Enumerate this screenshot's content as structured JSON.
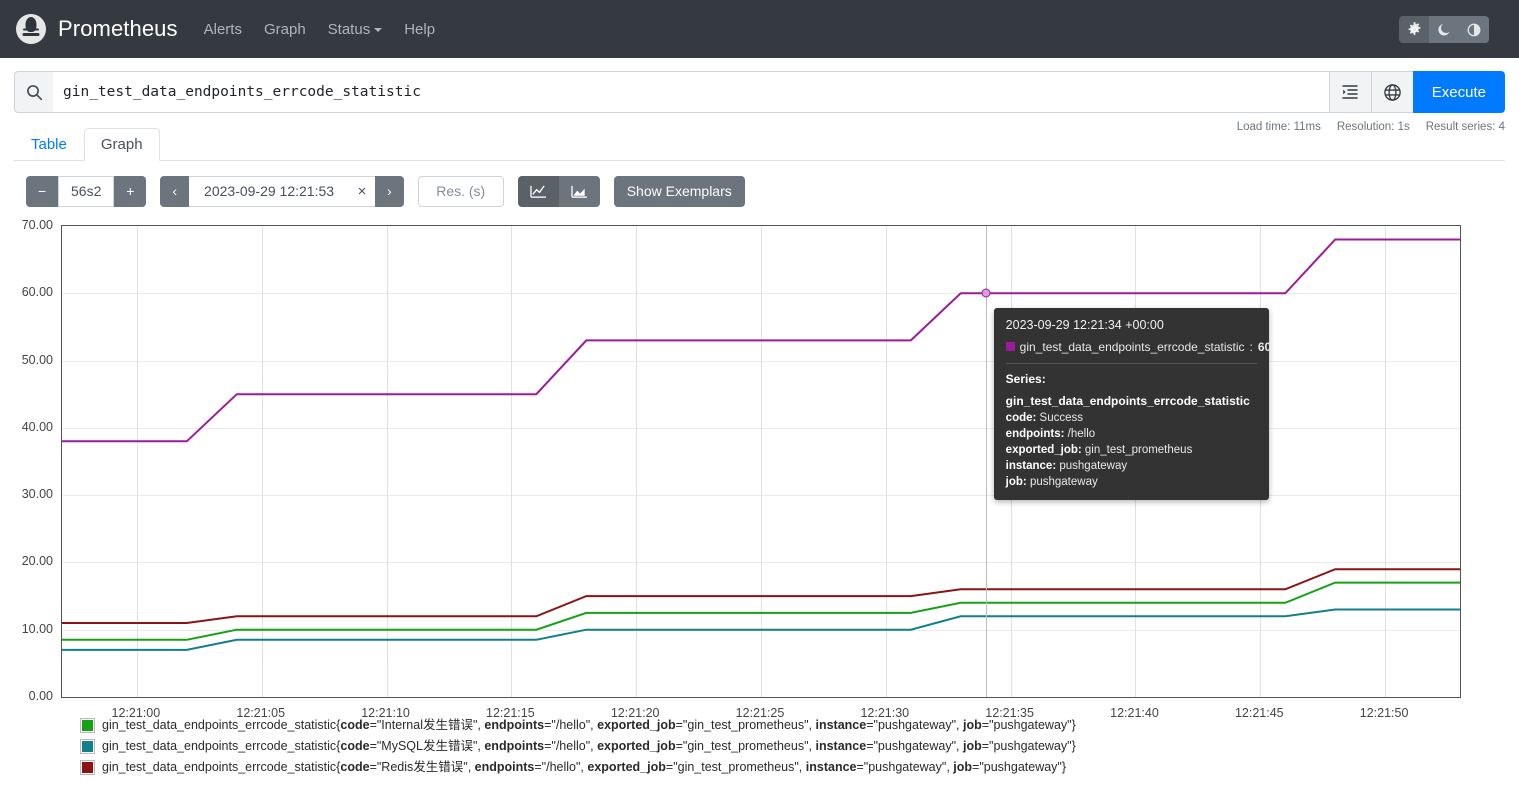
{
  "navbar": {
    "brand": "Prometheus",
    "links": [
      {
        "label": "Alerts"
      },
      {
        "label": "Graph"
      },
      {
        "label": "Status"
      },
      {
        "label": "Help"
      }
    ],
    "theme_buttons": [
      {
        "icon": "gear-icon",
        "glyph": "⚙"
      },
      {
        "icon": "moon-icon",
        "glyph": "☾"
      },
      {
        "icon": "half-circle-icon",
        "glyph": "◐"
      }
    ]
  },
  "search": {
    "icon": "search-icon",
    "expression": "gin_test_data_endpoints_errcode_statistic",
    "format_button": "format-expression-icon",
    "metrics_explorer_button": "globe-icon",
    "execute_label": "Execute"
  },
  "tabs": [
    {
      "label": "Table",
      "active": false
    },
    {
      "label": "Graph",
      "active": true
    }
  ],
  "meta": {
    "load_time": "Load time: 11ms",
    "resolution": "Resolution: 1s",
    "result_series": "Result series: 4"
  },
  "toolbar": {
    "decrease_label": "−",
    "range_value": "56s2",
    "increase_label": "+",
    "prev_label": "‹",
    "end_time": "2023-09-29 12:21:53",
    "clear_label": "×",
    "next_label": "›",
    "resolution_placeholder": "Res. (s)",
    "resolution_value": "",
    "line_chart_icon": "line-chart-icon",
    "stacked_chart_icon": "stacked-area-chart-icon",
    "show_exemplars_label": "Show Exemplars"
  },
  "tooltip": {
    "timestamp": "2023-09-29 12:21:34 +00:00",
    "metric_name": "gin_test_data_endpoints_errcode_statistic",
    "value": "60",
    "swatch_color": "#9c1a9c",
    "series_header": "Series:",
    "series_metric": "gin_test_data_endpoints_errcode_statistic",
    "labels": [
      {
        "key": "code",
        "value": "Success"
      },
      {
        "key": "endpoints",
        "value": "/hello"
      },
      {
        "key": "exported_job",
        "value": "gin_test_prometheus"
      },
      {
        "key": "instance",
        "value": "pushgateway"
      },
      {
        "key": "job",
        "value": "pushgateway"
      }
    ]
  },
  "legend": [
    {
      "color": "#15a215",
      "metric": "gin_test_data_endpoints_errcode_statistic",
      "labels": [
        {
          "key": "code",
          "value": "Internal发生错误"
        },
        {
          "key": "endpoints",
          "value": "/hello"
        },
        {
          "key": "exported_job",
          "value": "gin_test_prometheus"
        },
        {
          "key": "instance",
          "value": "pushgateway"
        },
        {
          "key": "job",
          "value": "pushgateway"
        }
      ]
    },
    {
      "color": "#10808c",
      "metric": "gin_test_data_endpoints_errcode_statistic",
      "labels": [
        {
          "key": "code",
          "value": "MySQL发生错误"
        },
        {
          "key": "endpoints",
          "value": "/hello"
        },
        {
          "key": "exported_job",
          "value": "gin_test_prometheus"
        },
        {
          "key": "instance",
          "value": "pushgateway"
        },
        {
          "key": "job",
          "value": "pushgateway"
        }
      ]
    },
    {
      "color": "#8b1313",
      "metric": "gin_test_data_endpoints_errcode_statistic",
      "labels": [
        {
          "key": "code",
          "value": "Redis发生错误"
        },
        {
          "key": "endpoints",
          "value": "/hello"
        },
        {
          "key": "exported_job",
          "value": "gin_test_prometheus"
        },
        {
          "key": "instance",
          "value": "pushgateway"
        },
        {
          "key": "job",
          "value": "pushgateway"
        }
      ]
    }
  ],
  "chart_data": {
    "type": "line",
    "title": "",
    "xlabel": "",
    "ylabel": "",
    "grid": true,
    "legend_position": "bottom",
    "ylim": [
      0,
      70
    ],
    "yticks": [
      0,
      10,
      20,
      30,
      40,
      50,
      60,
      70
    ],
    "ytick_labels": [
      "0.00",
      "10.00",
      "20.00",
      "30.00",
      "40.00",
      "50.00",
      "60.00",
      "70.00"
    ],
    "xlim": [
      "12:20:57",
      "12:21:53"
    ],
    "xticks": [
      "12:21:00",
      "12:21:05",
      "12:21:10",
      "12:21:15",
      "12:21:20",
      "12:21:25",
      "12:21:30",
      "12:21:35",
      "12:21:40",
      "12:21:45",
      "12:21:50"
    ],
    "hover": {
      "x": "12:21:34",
      "y": 60
    },
    "series": [
      {
        "name": "code=Success",
        "color": "#9c1a9c",
        "points": [
          {
            "t": "12:20:57",
            "v": 38
          },
          {
            "t": "12:21:02",
            "v": 38
          },
          {
            "t": "12:21:04",
            "v": 45
          },
          {
            "t": "12:21:16",
            "v": 45
          },
          {
            "t": "12:21:18",
            "v": 53
          },
          {
            "t": "12:21:31",
            "v": 53
          },
          {
            "t": "12:21:33",
            "v": 60
          },
          {
            "t": "12:21:46",
            "v": 60
          },
          {
            "t": "12:21:48",
            "v": 68
          },
          {
            "t": "12:21:53",
            "v": 68
          }
        ]
      },
      {
        "name": "code=Redis发生错误",
        "color": "#8b1313",
        "points": [
          {
            "t": "12:20:57",
            "v": 11
          },
          {
            "t": "12:21:02",
            "v": 11
          },
          {
            "t": "12:21:04",
            "v": 12
          },
          {
            "t": "12:21:16",
            "v": 12
          },
          {
            "t": "12:21:18",
            "v": 15
          },
          {
            "t": "12:21:31",
            "v": 15
          },
          {
            "t": "12:21:33",
            "v": 16
          },
          {
            "t": "12:21:46",
            "v": 16
          },
          {
            "t": "12:21:48",
            "v": 19
          },
          {
            "t": "12:21:53",
            "v": 19
          }
        ]
      },
      {
        "name": "code=Internal发生错误",
        "color": "#15a215",
        "points": [
          {
            "t": "12:20:57",
            "v": 8.5
          },
          {
            "t": "12:21:02",
            "v": 8.5
          },
          {
            "t": "12:21:04",
            "v": 10
          },
          {
            "t": "12:21:16",
            "v": 10
          },
          {
            "t": "12:21:18",
            "v": 12.5
          },
          {
            "t": "12:21:31",
            "v": 12.5
          },
          {
            "t": "12:21:33",
            "v": 14
          },
          {
            "t": "12:21:46",
            "v": 14
          },
          {
            "t": "12:21:48",
            "v": 17
          },
          {
            "t": "12:21:53",
            "v": 17
          }
        ]
      },
      {
        "name": "code=MySQL发生错误",
        "color": "#10808c",
        "points": [
          {
            "t": "12:20:57",
            "v": 7
          },
          {
            "t": "12:21:02",
            "v": 7
          },
          {
            "t": "12:21:04",
            "v": 8.5
          },
          {
            "t": "12:21:16",
            "v": 8.5
          },
          {
            "t": "12:21:18",
            "v": 10
          },
          {
            "t": "12:21:31",
            "v": 10
          },
          {
            "t": "12:21:33",
            "v": 12
          },
          {
            "t": "12:21:46",
            "v": 12
          },
          {
            "t": "12:21:48",
            "v": 13
          },
          {
            "t": "12:21:53",
            "v": 13
          }
        ]
      }
    ]
  }
}
